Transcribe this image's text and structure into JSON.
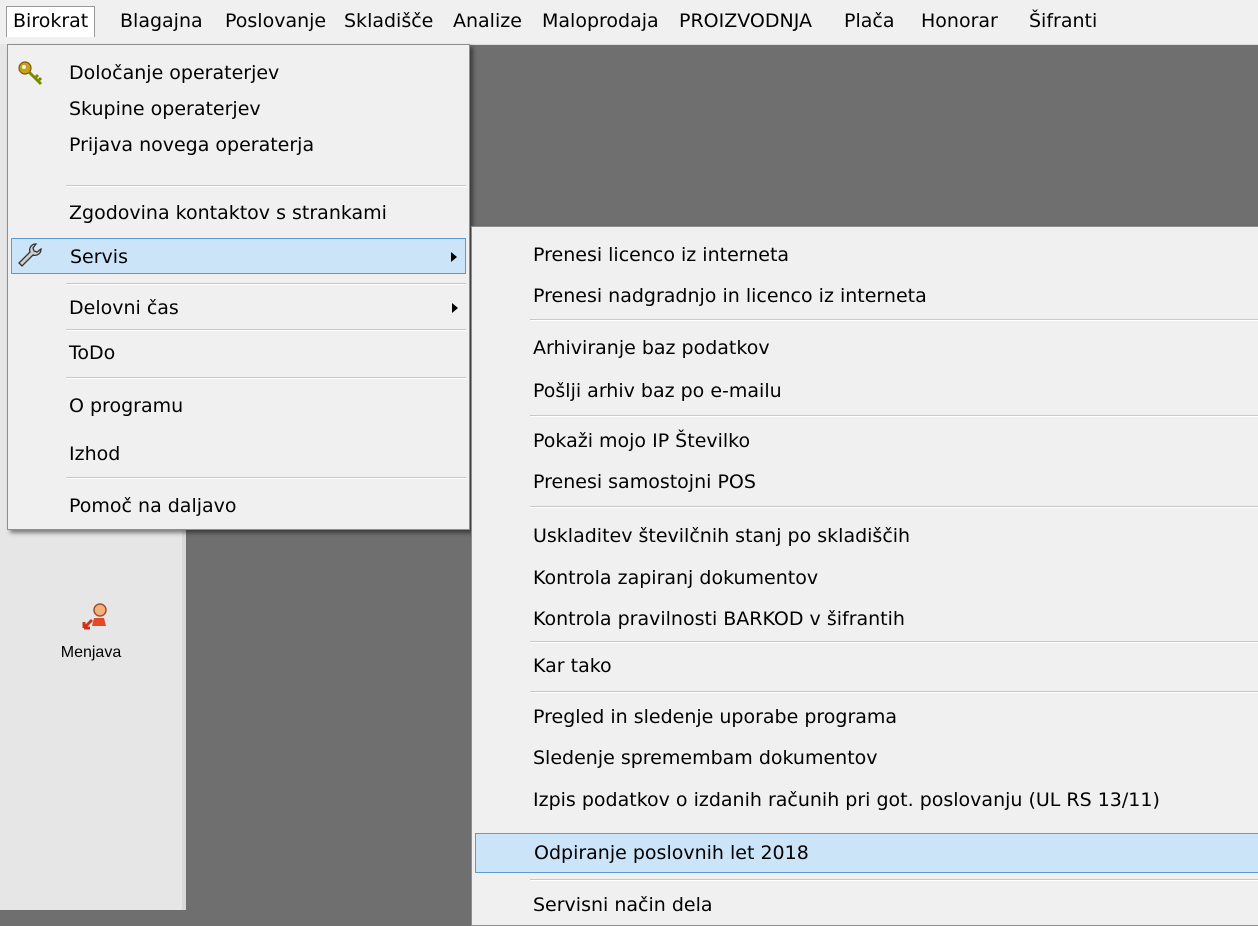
{
  "menubar": [
    {
      "label": "Birokrat",
      "active": true
    },
    {
      "label": "Blagajna"
    },
    {
      "label": "Poslovanje"
    },
    {
      "label": "Skladišče"
    },
    {
      "label": "Analize"
    },
    {
      "label": "Maloprodaja"
    },
    {
      "label": "PROIZVODNJA"
    },
    {
      "label": "Plača"
    },
    {
      "label": "Honorar"
    },
    {
      "label": "Šifranti"
    }
  ],
  "left_panel": {
    "button_label": "Menjava",
    "button_icon": "user-swap-icon"
  },
  "birokrat_menu": {
    "items": [
      {
        "label": "Določanje operaterjev",
        "icon": "key-icon"
      },
      {
        "label": "Skupine operaterjev"
      },
      {
        "label": "Prijava novega operaterja"
      },
      {
        "label": "Zgodovina kontaktov s strankami"
      },
      {
        "label": "Servis",
        "icon": "wrench-icon",
        "submenu": true,
        "highlighted": true
      },
      {
        "label": "Delovni čas",
        "submenu": true
      },
      {
        "label": "ToDo"
      },
      {
        "label": "O programu"
      },
      {
        "label": "Izhod"
      },
      {
        "label": "Pomoč na daljavo"
      }
    ]
  },
  "servis_menu": {
    "items": [
      {
        "label": "Prenesi licenco iz interneta"
      },
      {
        "label": "Prenesi nadgradnjo in licenco iz interneta"
      },
      {
        "label": "Arhiviranje baz podatkov"
      },
      {
        "label": "Pošlji arhiv baz po e-mailu"
      },
      {
        "label": "Pokaži mojo IP Številko"
      },
      {
        "label": "Prenesi samostojni POS"
      },
      {
        "label": "Uskladitev številčnih stanj po skladiščih"
      },
      {
        "label": "Kontrola zapiranj dokumentov",
        "submenu": true
      },
      {
        "label": "Kontrola pravilnosti BARKOD v šifrantih"
      },
      {
        "label": "Kar tako",
        "submenu": true
      },
      {
        "label": "Pregled in sledenje uporabe programa"
      },
      {
        "label": "Sledenje spremembam dokumentov"
      },
      {
        "label": "Izpis podatkov o izdanih računih pri got. poslovanju (UL RS 13/11)"
      },
      {
        "label": "Odpiranje poslovnih let 2018",
        "highlighted": true
      },
      {
        "label": "Servisni način dela"
      }
    ]
  },
  "colors": {
    "highlight_bg": "#cce4f7",
    "highlight_border": "#5a9bd5",
    "workspace": "#6f6f6f"
  }
}
